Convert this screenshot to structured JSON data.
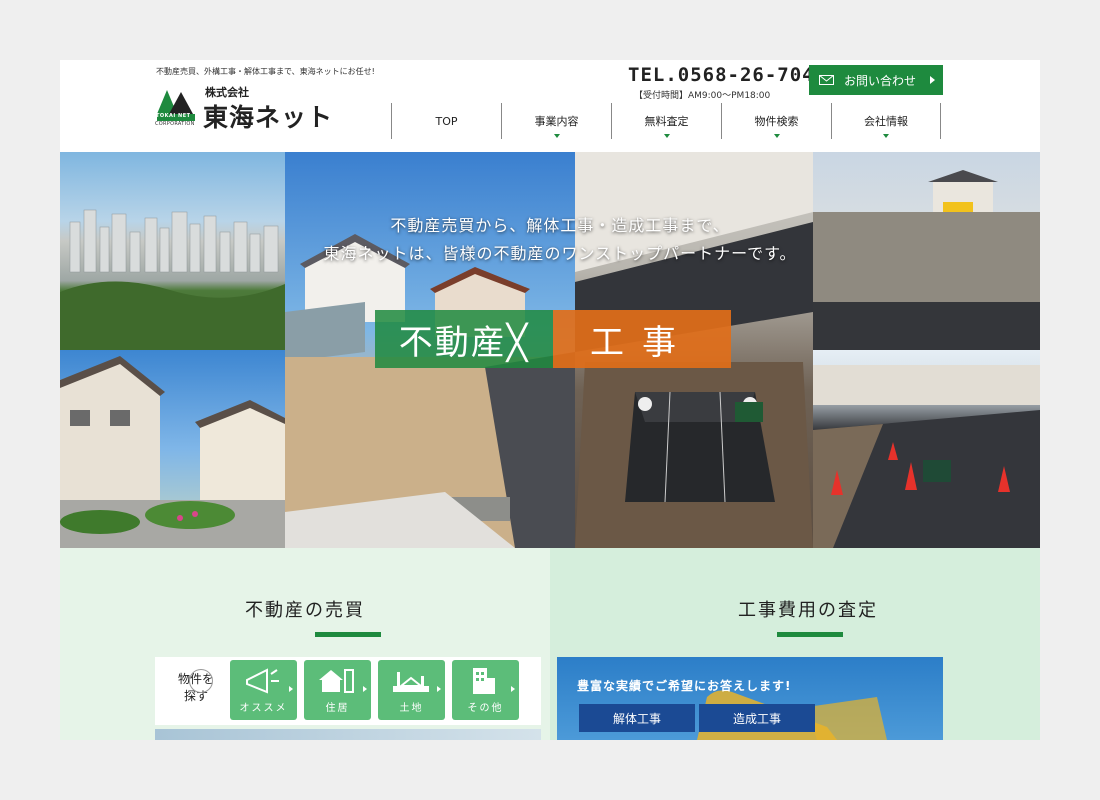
{
  "header": {
    "tagline": "不動産売買、外構工事・解体工事まで、東海ネットにお任せ!",
    "logo_small": "株式会社",
    "logo_big": "東海ネット",
    "logo_mark_text": "TOKAI NET",
    "logo_corp": "CORPORATION",
    "tel": "TEL.0568-26-7044",
    "hours": "【受付時間】AM9:00〜PM18:00",
    "contact_label": "お問い合わせ"
  },
  "nav": {
    "items": [
      {
        "label": "TOP"
      },
      {
        "label": "事業内容"
      },
      {
        "label": "無料査定"
      },
      {
        "label": "物件検索"
      },
      {
        "label": "会社情報"
      }
    ]
  },
  "hero": {
    "line1": "不動産売買から、解体工事・造成工事まで、",
    "line2": "東海ネットは、皆様の不動産のワンストップパートナーです。",
    "title_a": "不動産╳",
    "title_b": "工事"
  },
  "sections": {
    "left_title": "不動産の売買",
    "right_title": "工事費用の査定"
  },
  "search": {
    "label_1": "物件を",
    "label_2": "探す",
    "categories": [
      {
        "label": "オススメ",
        "icon": "megaphone-icon"
      },
      {
        "label": "住居",
        "icon": "house-icon"
      },
      {
        "label": "土地",
        "icon": "land-icon"
      },
      {
        "label": "その他",
        "icon": "building-icon"
      }
    ]
  },
  "kouji": {
    "text": "豊富な実績でご希望にお答えします!",
    "tabs": [
      {
        "label": "解体工事"
      },
      {
        "label": "造成工事"
      }
    ]
  },
  "colors": {
    "brand_green": "#1e8a3e",
    "accent_orange": "#e16e19",
    "category_green": "#5cbd79",
    "kouji_blue": "#1b4a94"
  }
}
